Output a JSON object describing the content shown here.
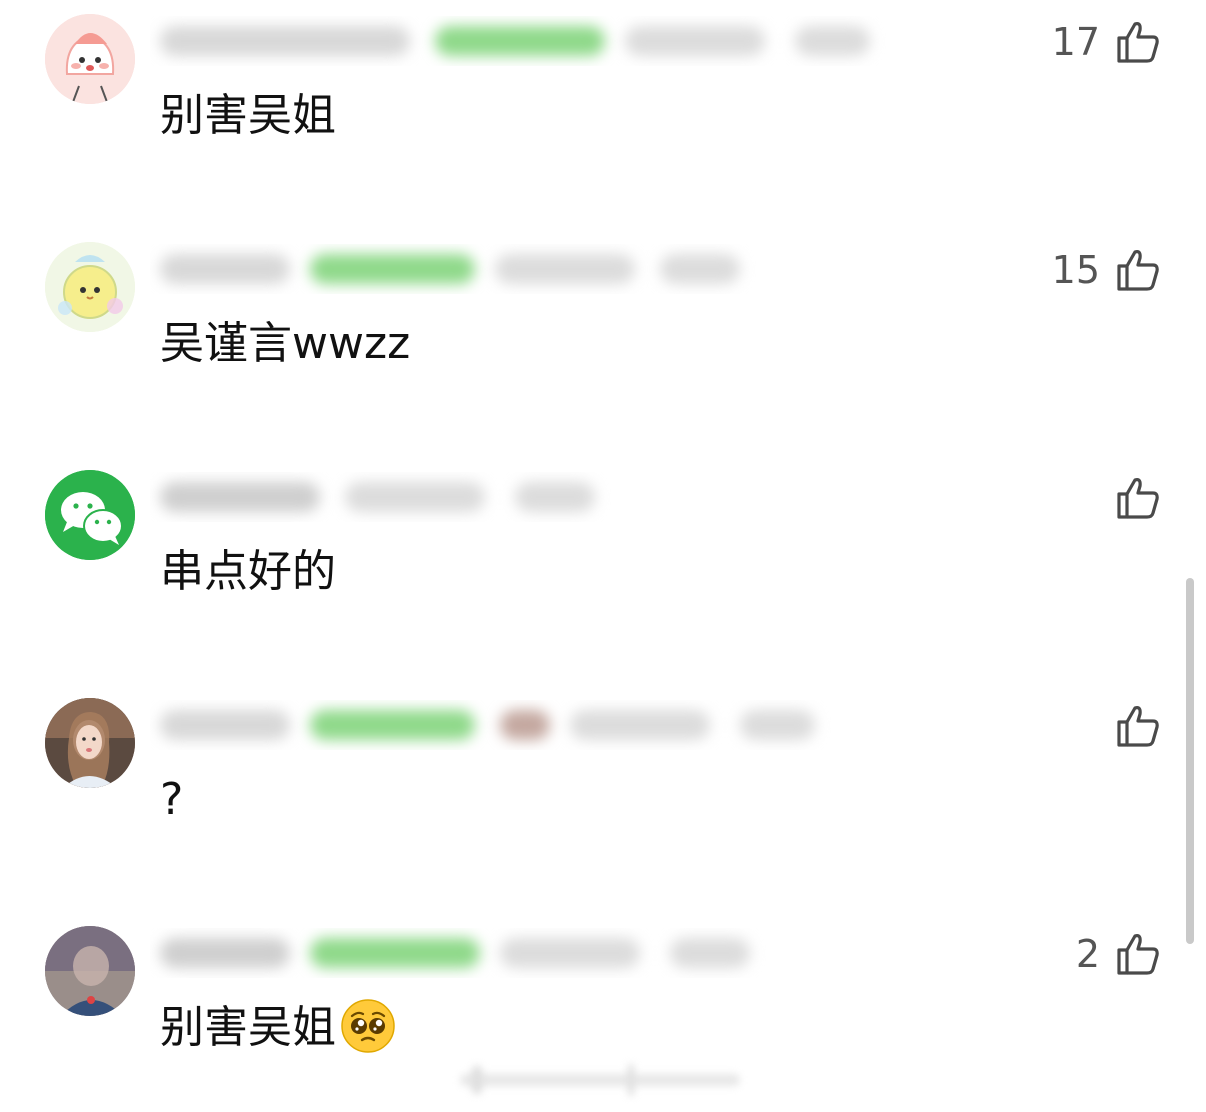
{
  "comments": [
    {
      "text": "别害吴姐",
      "likes": "17",
      "emoji": ""
    },
    {
      "text": "吴谨言wwzz",
      "likes": "15",
      "emoji": ""
    },
    {
      "text": "串点好的",
      "likes": "",
      "emoji": ""
    },
    {
      "text": "?",
      "likes": "",
      "emoji": ""
    },
    {
      "text": "别害吴姐",
      "likes": "2",
      "emoji": "pleading-face"
    }
  ],
  "colors": {
    "like_icon": "#4a4a4a",
    "like_count": "#555555",
    "badge_green": "#7ed67a",
    "blur_gray": "#cfcfcf",
    "wechat_green": "#2bb24c"
  }
}
